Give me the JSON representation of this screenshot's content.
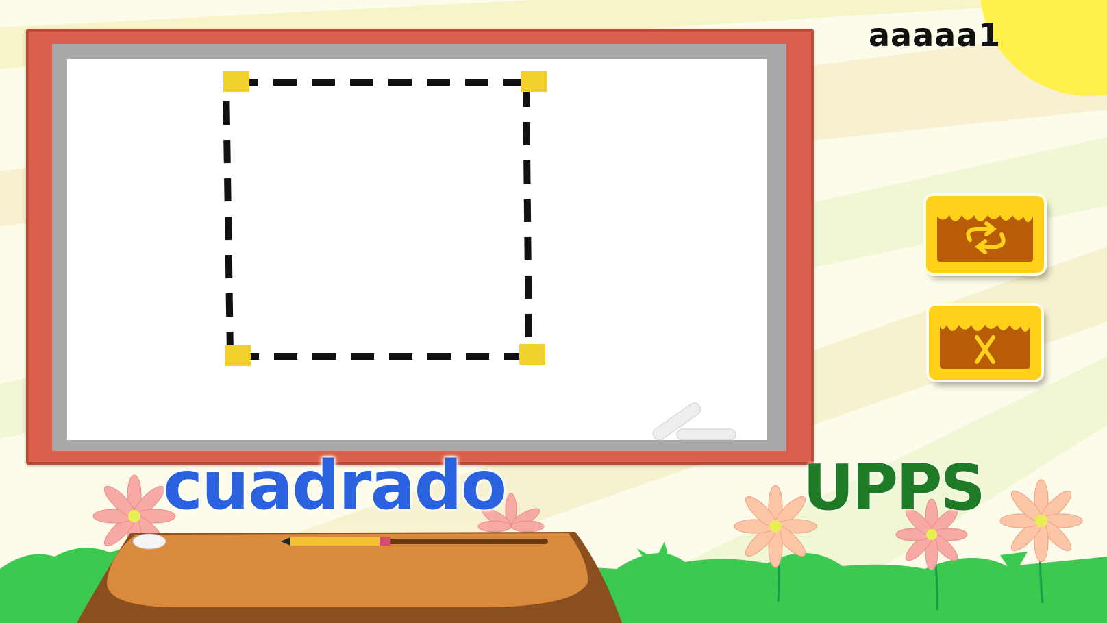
{
  "player": {
    "name": "aaaaa1"
  },
  "shape": {
    "word": "cuadrado"
  },
  "status": {
    "text": "UPPS"
  },
  "buttons": [
    {
      "id": "restart",
      "icon": "restart-arrows-icon"
    },
    {
      "id": "close",
      "icon": "close-x-icon"
    }
  ],
  "colors": {
    "board_frame": "#d9604d",
    "shape_word": "#2a62e0",
    "status_word": "#1f7a25",
    "corner_dot": "#f2d12c",
    "button": "#ffd11a",
    "grass": "#3cc94f",
    "sun": "#fff14a"
  }
}
